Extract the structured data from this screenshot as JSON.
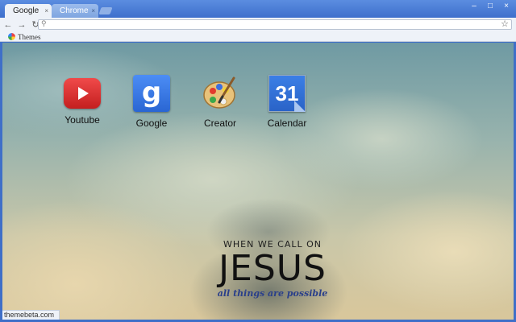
{
  "tabs": [
    {
      "label": "Google",
      "active": true
    },
    {
      "label": "Chrome",
      "active": false
    }
  ],
  "tab_close": "×",
  "window_controls": {
    "minimize": "–",
    "maximize": "□",
    "close": "×"
  },
  "toolbar": {
    "back": "←",
    "forward": "→",
    "reload": "↻",
    "omnibox_value": "",
    "omnibox_placeholder": "",
    "search_icon": "⚲",
    "star": "☆"
  },
  "bookmarks": [
    {
      "label": "Themes",
      "icon": "chrome-web-store-icon"
    }
  ],
  "apps": [
    {
      "label": "Youtube",
      "icon": "youtube-icon"
    },
    {
      "label": "Google",
      "icon": "google-search-icon"
    },
    {
      "label": "Creator",
      "icon": "palette-icon"
    },
    {
      "label": "Calendar",
      "icon": "calendar-icon",
      "day": "31"
    }
  ],
  "google_letter": "g",
  "verse": {
    "line1": "WHEN WE CALL ON",
    "line2": "JESUS",
    "line3": "all things are possible"
  },
  "status_text": "themebeta.com",
  "colors": {
    "frame": "#3f6fc8",
    "toolbar": "#eef2f8",
    "accent_blue": "#2a66d3"
  }
}
